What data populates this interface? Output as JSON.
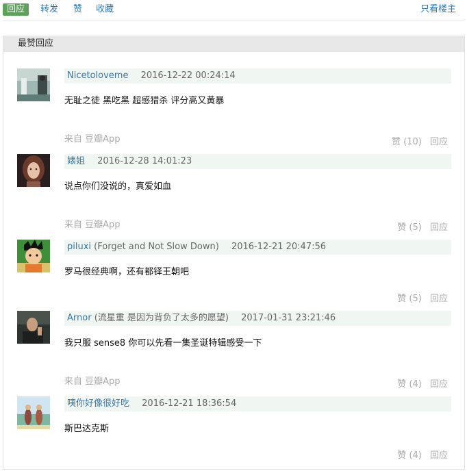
{
  "toolbar": {
    "reply": "回应",
    "repost": "转发",
    "like": "赞",
    "collect": "收藏",
    "op_only": "只看楼主",
    "colors": {
      "accent": "#5da15a",
      "link": "#3377aa"
    }
  },
  "section": {
    "title": "最赞回应"
  },
  "comments": [
    {
      "user": "Nicetoloveme",
      "note": "",
      "time": "2016-12-22 00:24:14",
      "content": "无耻之徒 黑吃黑 超感猎杀 评分高又黄暴",
      "source": "来自 豆瓣App",
      "likes": "赞 (10)",
      "reply": "回应"
    },
    {
      "user": "婊姐",
      "note": "",
      "time": "2016-12-28 14:01:23",
      "content": "说点你们没说的，真爱如血",
      "source": "来自 豆瓣App",
      "likes": "赞 (5)",
      "reply": "回应"
    },
    {
      "user": "piluxi",
      "note": "(Forget and Not Slow Down)",
      "time": "2016-12-21 20:47:56",
      "content": "罗马很经典啊，还有都铎王朝吧",
      "source": "",
      "likes": "赞 (5)",
      "reply": "回应"
    },
    {
      "user": "Arnor",
      "note": "(流星重 是因为背负了太多的愿望)",
      "time": "2017-01-31 23:21:46",
      "content": "我只服 sense8 你可以先看一集圣诞特辑感受一下",
      "source": "来自 豆瓣App",
      "likes": "赞 (4)",
      "reply": "回应"
    },
    {
      "user": "咦你好像很好吃",
      "note": "",
      "time": "2016-12-21 18:36:54",
      "content": "斯巴达克斯",
      "source": "",
      "likes": "赞 (4)",
      "reply": "回应"
    }
  ]
}
